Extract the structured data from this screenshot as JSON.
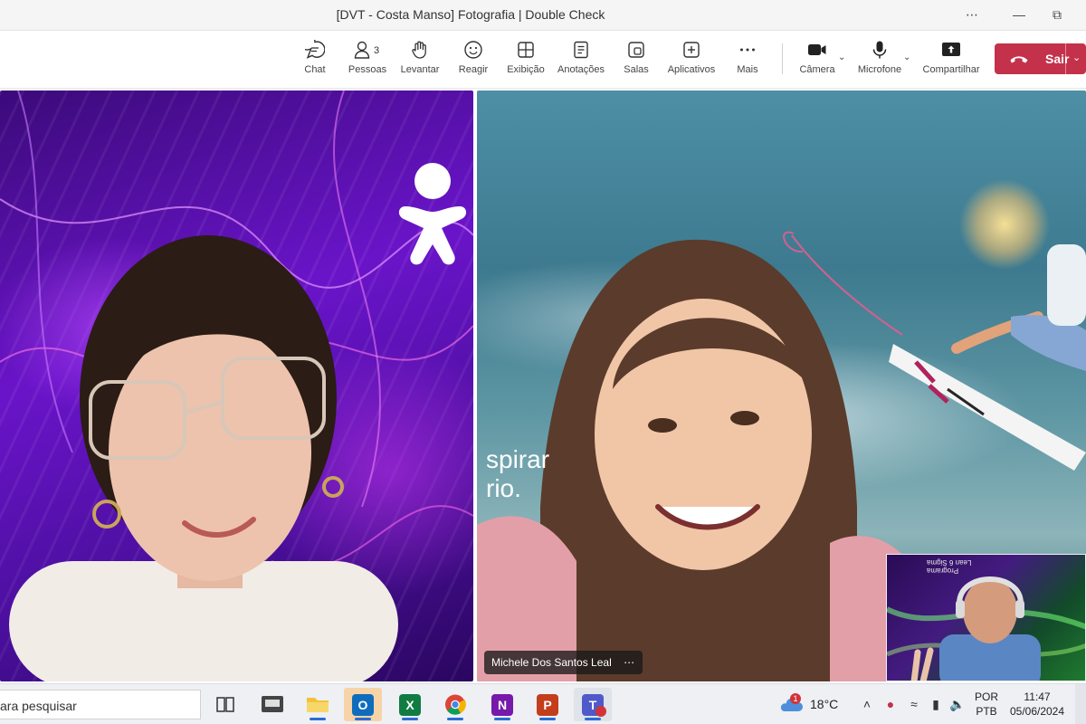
{
  "window": {
    "title": "[DVT - Costa Manso] Fotografia | Double Check",
    "controls": {
      "more": "⋯",
      "minimize": "—",
      "restore": "⧉"
    }
  },
  "toolbar": {
    "chat_label": "Chat",
    "people_label": "Pessoas",
    "people_count": "3",
    "raise_label": "Levantar",
    "react_label": "Reagir",
    "view_label": "Exibição",
    "notes_label": "Anotações",
    "rooms_label": "Salas",
    "apps_label": "Aplicativos",
    "more_label": "Mais",
    "camera_label": "Câmera",
    "mic_label": "Microfone",
    "share_label": "Compartilhar",
    "leave_label": "Sair"
  },
  "stage": {
    "right_tile": {
      "background_text_line1": "spirar",
      "background_text_line2": "rio.",
      "participant_name": "Michele Dos Santos Leal",
      "more": "⋯"
    },
    "self_view": {
      "caption_line1": "Programa",
      "caption_line2": "Lean 6 Sigma"
    }
  },
  "taskbar": {
    "search_text": "ara pesquisar",
    "weather_temp": "18°C",
    "weather_badge": "1",
    "language_line1": "POR",
    "language_line2": "PTB",
    "time": "11:47",
    "date": "05/06/2024",
    "apps": [
      {
        "name": "Outlook",
        "letter": "O",
        "color": "#0f6cbd"
      },
      {
        "name": "Excel",
        "letter": "X",
        "color": "#107c41"
      },
      {
        "name": "OneNote",
        "letter": "N",
        "color": "#7719aa"
      },
      {
        "name": "PowerPoint",
        "letter": "P",
        "color": "#c43e1c"
      },
      {
        "name": "Teams",
        "letter": "T",
        "color": "#5059c9"
      }
    ]
  },
  "colors": {
    "leave_button": "#c4314b",
    "active_app_highlight": "#f7d4a8",
    "running_indicator": "#2b6cd4"
  }
}
